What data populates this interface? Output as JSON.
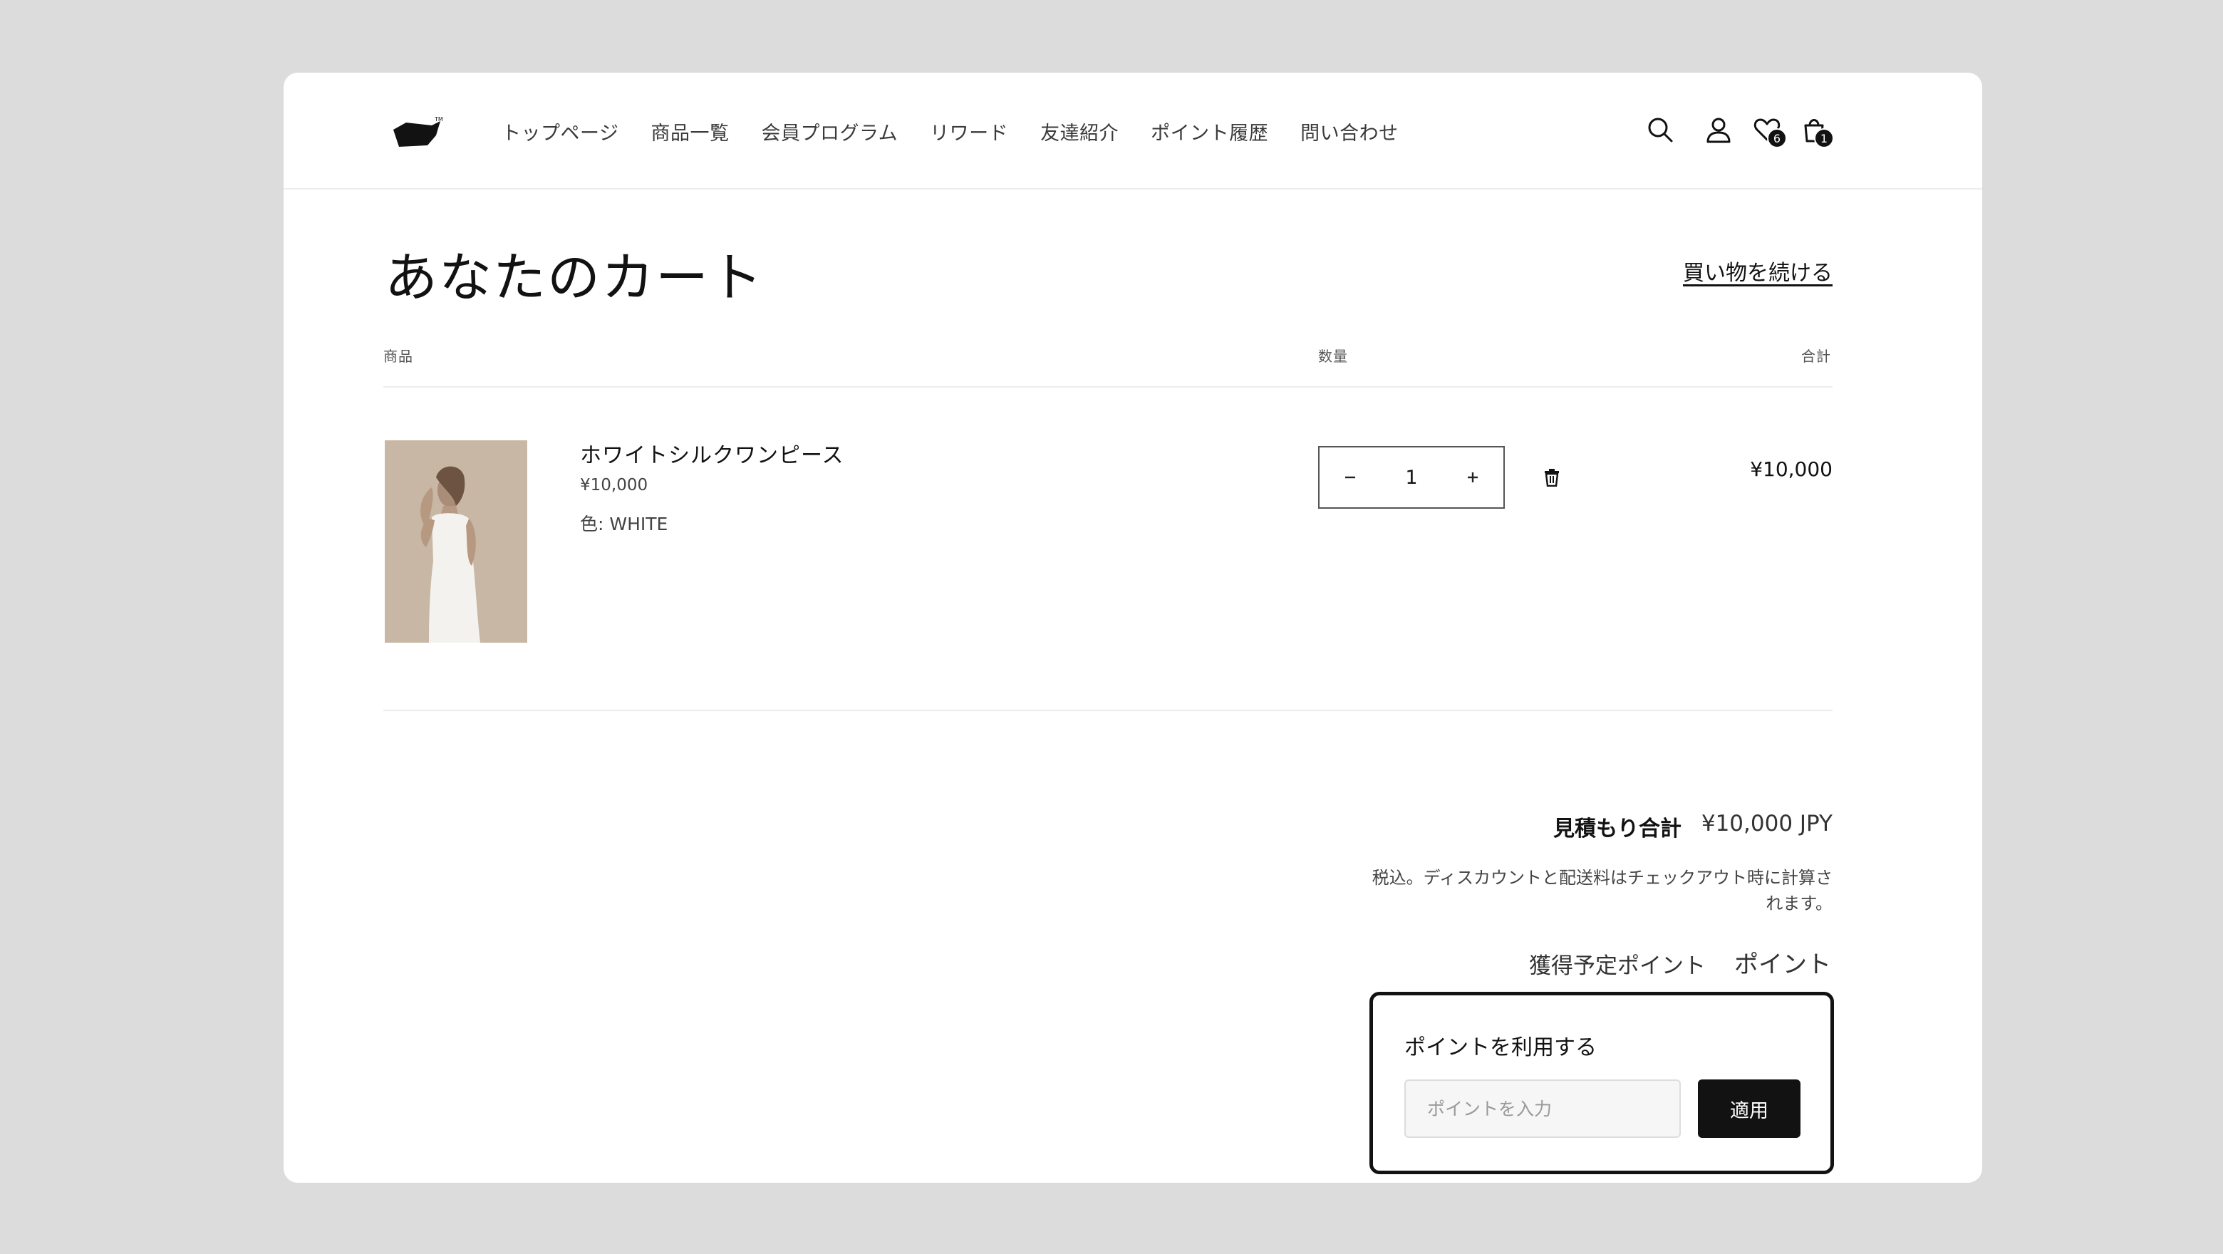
{
  "header": {
    "nav": [
      "トップページ",
      "商品一覧",
      "会員プログラム",
      "リワード",
      "友達紹介",
      "ポイント履歴",
      "問い合わせ"
    ],
    "icons": {
      "search": "search-icon",
      "account": "account-icon",
      "wishlist": "heart-icon",
      "cart": "cart-icon"
    },
    "wishlist_count": "6",
    "cart_count": "1"
  },
  "cart": {
    "title": "あなたのカート",
    "continue_shopping": "買い物を続ける",
    "columns": {
      "product": "商品",
      "quantity": "数量",
      "total": "合計"
    },
    "items": [
      {
        "name": "ホワイトシルクワンピース",
        "price": "¥10,000",
        "variant": "色: WHITE",
        "quantity": "1",
        "line_total": "¥10,000"
      }
    ]
  },
  "summary": {
    "estimated_total_label": "見積もり合計",
    "estimated_total_value": "¥10,000 JPY",
    "tax_note": "税込。ディスカウントと配送料はチェックアウト時に計算されます。",
    "earn_points_label": "獲得予定ポイント",
    "earn_points_value": "ポイント"
  },
  "points": {
    "title": "ポイントを利用する",
    "placeholder": "ポイントを入力",
    "apply_label": "適用"
  },
  "colors": {
    "page_bg": "#dcdcdc",
    "surface": "#ffffff",
    "text": "#121212",
    "button_dark": "#121212"
  }
}
